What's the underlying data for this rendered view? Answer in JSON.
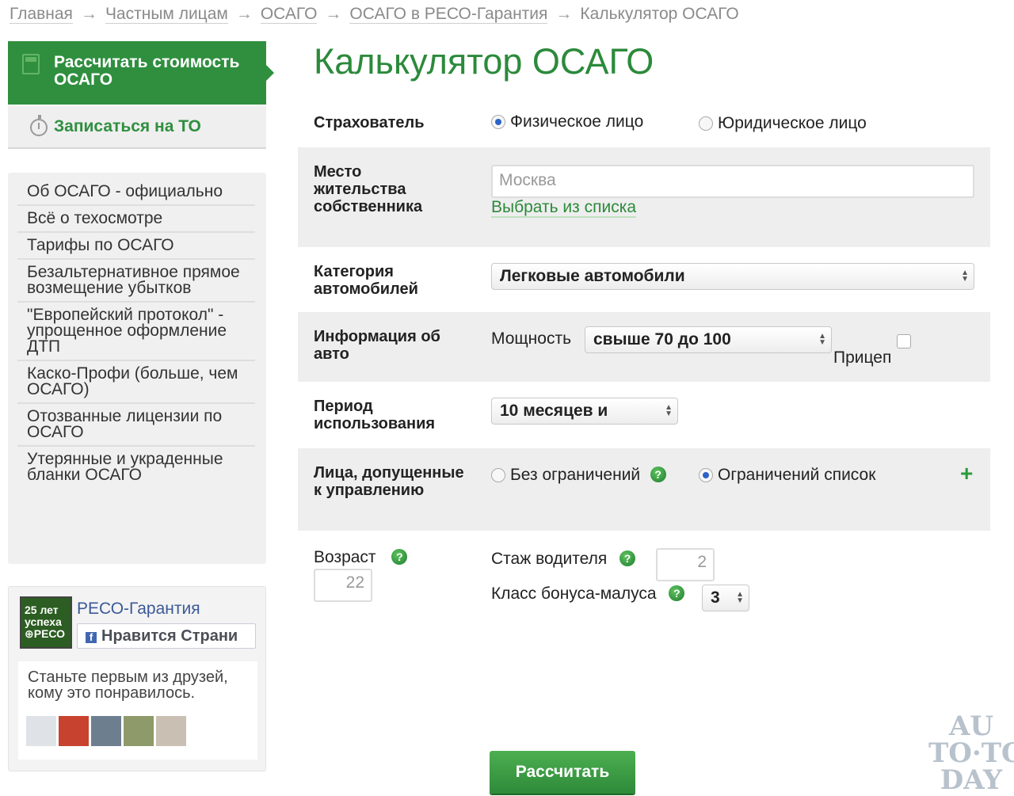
{
  "breadcrumb": {
    "items": [
      "Главная",
      "Частным лицам",
      "ОСАГО",
      "ОСАГО в РЕСО-Гарантия"
    ],
    "current": "Калькулятор ОСАГО",
    "separator": "→"
  },
  "sidebar": {
    "calc_button": "Рассчитать стоимость ОСАГО",
    "to_button": "Записаться на ТО",
    "menu": [
      "Об ОСАГО - официально",
      "Всё о техосмотре",
      "Тарифы по ОСАГО",
      "Безальтернативное прямое возмещение убытков",
      "\"Европейский протокол\" - упрощенное оформление ДТП",
      "Каско-Профи (больше, чем ОСАГО)",
      "Отозванные лицензии по ОСАГО",
      "Утерянные и украденные бланки ОСАГО"
    ]
  },
  "facebook": {
    "logo_text": "25 лет успеха ⊕РЕСО",
    "page_name": "РЕСО-Гарантия",
    "like_label": "Нравится Страни",
    "social_text": "Станьте первым из друзей, кому это понравилось."
  },
  "form": {
    "title": "Калькулятор ОСАГО",
    "insurer": {
      "label": "Страхователь",
      "option_individual": "Физическое лицо",
      "option_legal": "Юридическое лицо",
      "selected": "Физическое лицо"
    },
    "residence": {
      "label": "Место жительства собственника",
      "placeholder": "Москва",
      "choose_link": "Выбрать из списка"
    },
    "category": {
      "label": "Категория автомобилей",
      "value": "Легковые автомобили"
    },
    "car_info": {
      "label": "Информация об авто",
      "power_label": "Мощность",
      "power_value": "свыше 70 до 100",
      "trailer_label": "Прицеп",
      "trailer_checked": false
    },
    "period": {
      "label": "Период использования",
      "value": "10 месяцев и"
    },
    "drivers": {
      "label": "Лица, допущенные к управлению",
      "option_unlimited": "Без ограничений",
      "option_limited": "Ограничений список",
      "selected": "Ограничений список"
    },
    "age": {
      "label": "Возраст",
      "value": "22"
    },
    "experience": {
      "label": "Стаж водителя",
      "value": "2"
    },
    "bonus": {
      "label": "Класс бонуса-малуса",
      "value": "3"
    },
    "help_symbol": "?",
    "add_symbol": "+",
    "submit": "Рассчитать"
  },
  "watermark": {
    "line1": "AU",
    "line2": "TO·TO",
    "line3": "DAY"
  },
  "colors": {
    "brand_green": "#2f8f3f",
    "link_blue": "#3b5998",
    "row_gray": "#eeeeee"
  }
}
